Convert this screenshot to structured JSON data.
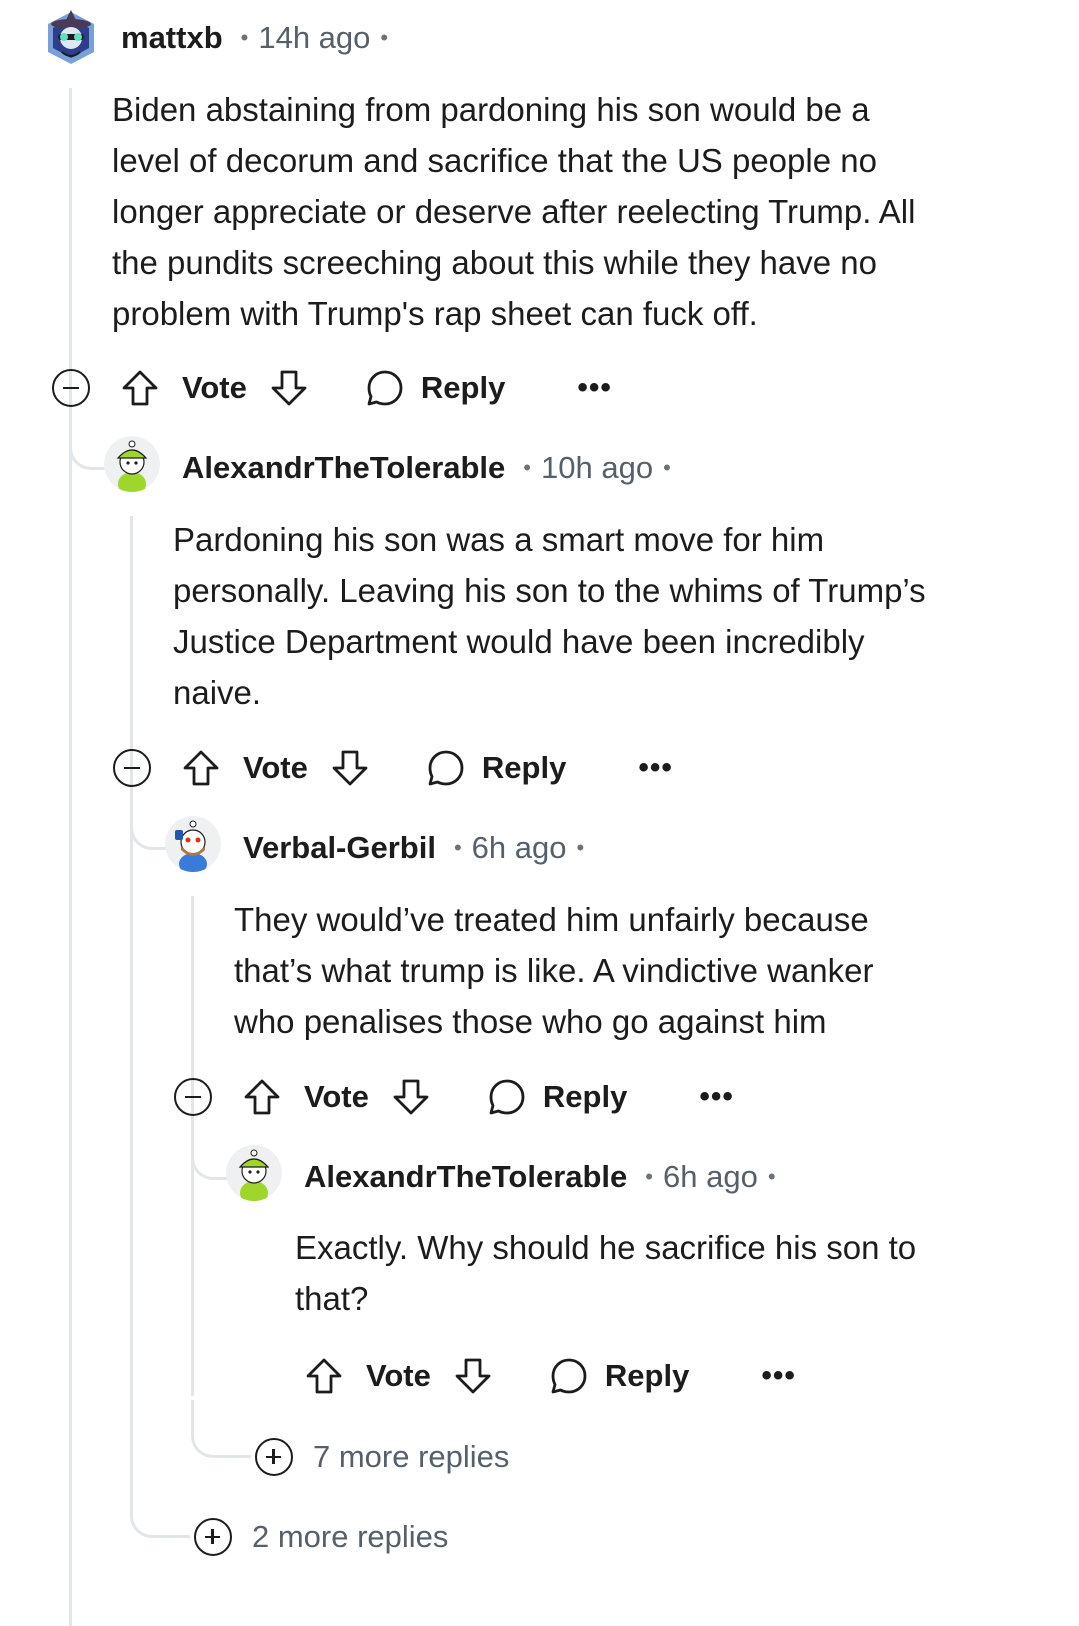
{
  "actions": {
    "vote_label": "Vote",
    "reply_label": "Reply",
    "more_label": "•••"
  },
  "comments": [
    {
      "author": "mattxb",
      "time": "14h ago",
      "body": "Biden abstaining from pardoning his son would be a\nlevel of decorum and sacrifice that the US people no\nlonger appreciate or deserve after reelecting Trump. All\nthe pundits screeching about this while they have no\nproblem with Trump's rap sheet can fuck off."
    },
    {
      "author": "AlexandrTheTolerable",
      "time": "10h ago",
      "body": "Pardoning his son was a smart move for him\npersonally. Leaving his son to the whims of Trump’s\nJustice Department would have been incredibly\nnaive."
    },
    {
      "author": "Verbal-Gerbil",
      "time": "6h ago",
      "body": "They would’ve treated him unfairly because\nthat’s what trump is like. A vindictive wanker\nwho penalises those who go against him"
    },
    {
      "author": "AlexandrTheTolerable",
      "time": "6h ago",
      "body": "Exactly. Why should he sacrifice his son to\nthat?"
    }
  ],
  "more_replies": [
    {
      "label": "7 more replies"
    },
    {
      "label": "2 more replies"
    }
  ],
  "colors": {
    "thread_line": "#e3e6e8",
    "text": "#1c1c1c",
    "muted": "#56606a"
  },
  "icons": {
    "upvote": "arrow-up-icon",
    "downvote": "arrow-down-icon",
    "reply": "speech-bubble-icon",
    "collapse": "minus-circle-icon",
    "expand": "plus-circle-icon"
  }
}
